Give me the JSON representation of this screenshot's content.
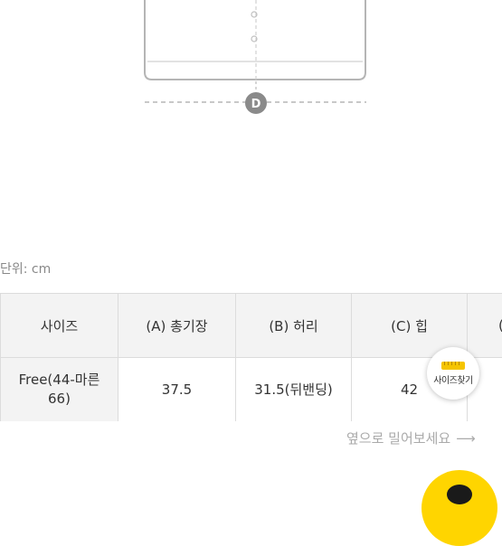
{
  "diagram": {
    "marker_d": "D"
  },
  "unit_label": "단위: cm",
  "size_table": {
    "headers": [
      "사이즈",
      "(A) 총기장",
      "(B) 허리",
      "(C) 힙",
      "("
    ],
    "rows": [
      {
        "size": "Free(44-마른 66)",
        "a": "37.5",
        "b": "31.5(뒤밴딩)",
        "c": "42"
      }
    ]
  },
  "swipe_hint": "옆으로 밀어보세요",
  "size_finder_label": "사이즈찾기",
  "colors": {
    "accent_yellow": "#ffd500",
    "header_bg": "#f3f3f3",
    "border": "#dcdcdc",
    "marker_gray": "#8a8a8a"
  }
}
